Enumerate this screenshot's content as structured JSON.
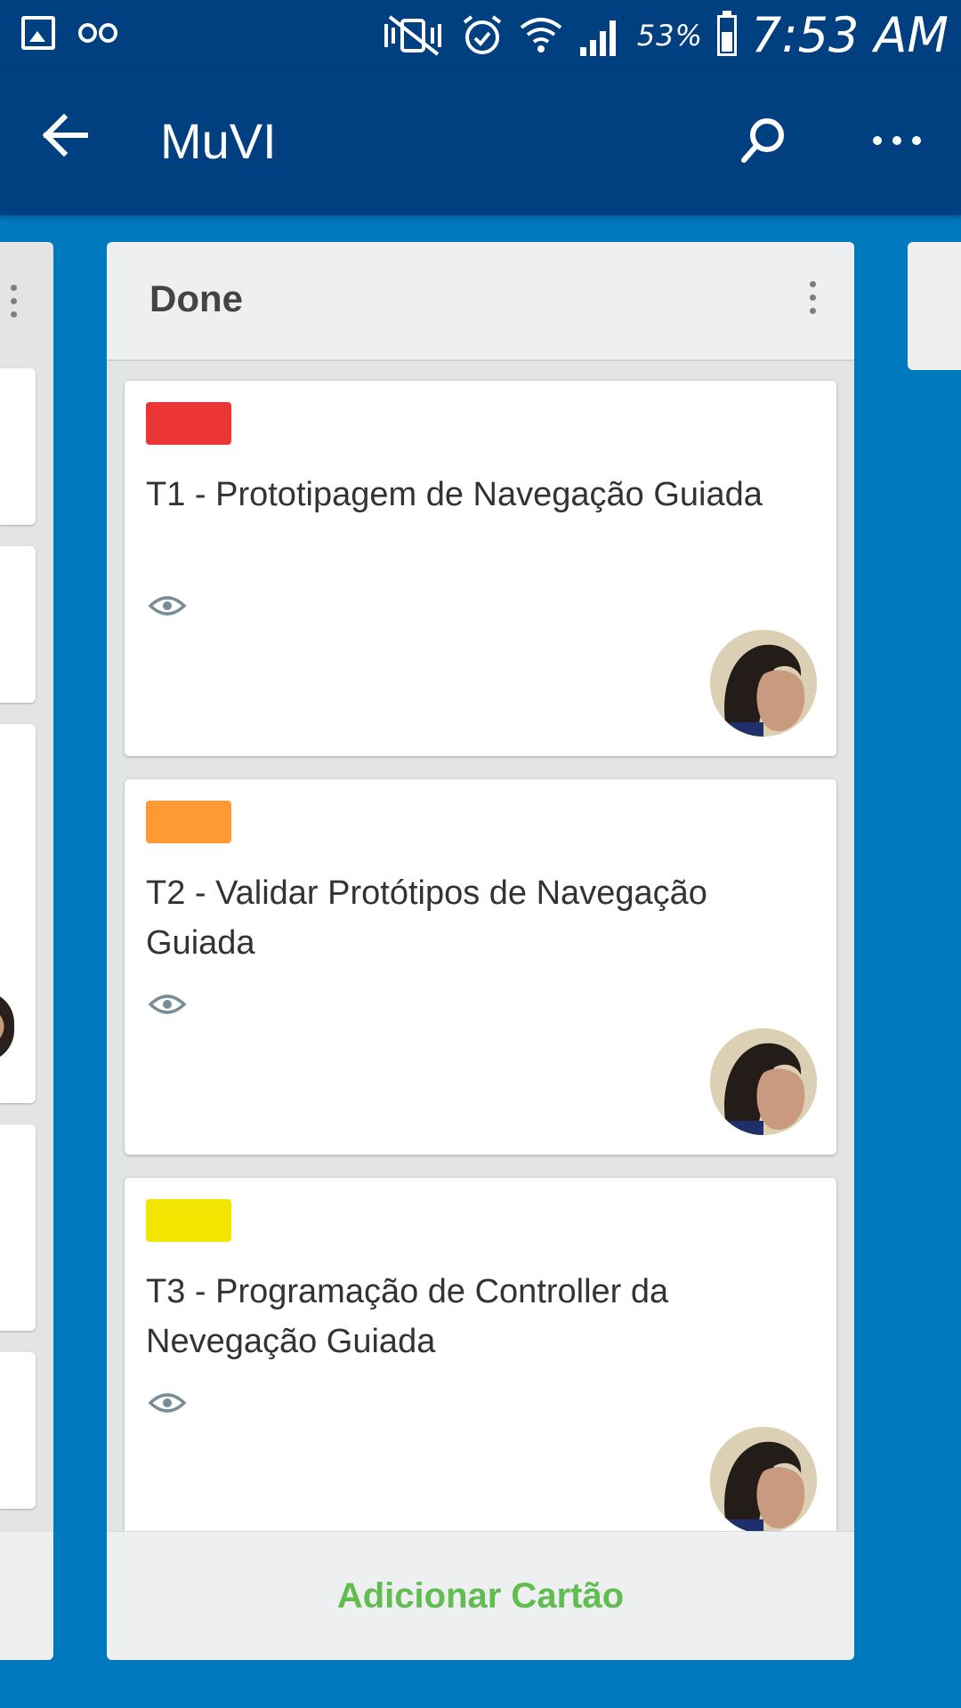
{
  "status_bar": {
    "battery_percent": "53%",
    "time": "7:53 AM",
    "icons": [
      "gallery-icon",
      "voicemail-icon",
      "vibrate-off-icon",
      "alarm-icon",
      "wifi-icon",
      "signal-icon",
      "battery-icon"
    ]
  },
  "app_bar": {
    "title": "MuVI",
    "icons": [
      "back-arrow-icon",
      "search-icon",
      "more-horizontal-icon"
    ]
  },
  "list": {
    "title": "Done",
    "cards": [
      {
        "title": "T1 - Prototipagem de Navegação Guiada",
        "label_color": "#eb3434",
        "watching": true
      },
      {
        "title": "T2 - Validar Protótipos de Navegação Guiada",
        "label_color": "#ff9933",
        "watching": true
      },
      {
        "title": "T3 - Programação de Controller da Nevegação Guiada",
        "label_color": "#f2e600",
        "watching": true
      }
    ],
    "add_card_label": "Adicionar Cartão"
  },
  "colors": {
    "board_background": "#0079bf",
    "app_bar": "#003f80",
    "add_card_text": "#61bd4f"
  }
}
